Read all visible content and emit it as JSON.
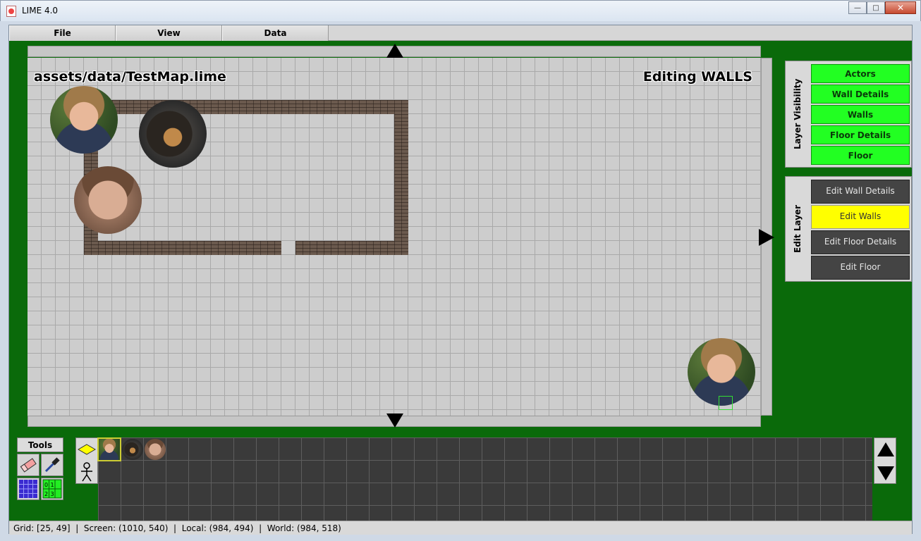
{
  "window": {
    "title": "LIME 4.0",
    "minimize_icon": "minimize-icon",
    "maximize_icon": "maximize-icon",
    "close_icon": "close-icon"
  },
  "menubar": {
    "items": [
      {
        "label": "File"
      },
      {
        "label": "View"
      },
      {
        "label": "Data"
      }
    ]
  },
  "map": {
    "filename": "assets/data/TestMap.lime",
    "mode": "Editing WALLS",
    "scroll_up_icon": "triangle-up-icon",
    "scroll_down_icon": "triangle-down-icon",
    "scroll_right_icon": "triangle-right-icon"
  },
  "layer_visibility": {
    "title": "Layer Visibility",
    "items": [
      {
        "label": "Actors"
      },
      {
        "label": "Wall Details"
      },
      {
        "label": "Walls"
      },
      {
        "label": "Floor Details"
      },
      {
        "label": "Floor"
      }
    ],
    "color": "#22ff22"
  },
  "edit_layer": {
    "title": "Edit Layer",
    "items": [
      {
        "label": "Edit Wall Details",
        "active": false
      },
      {
        "label": "Edit Walls",
        "active": true
      },
      {
        "label": "Edit Floor Details",
        "active": false
      },
      {
        "label": "Edit Floor",
        "active": false
      }
    ],
    "active_color": "#ffff00"
  },
  "tools": {
    "title": "Tools",
    "items": [
      "eraser-icon",
      "eyedropper-icon",
      "grid-icon",
      "numbered-grid-icon"
    ],
    "numbered_grid_text": "0 1 2 3"
  },
  "palette": {
    "tabs": [
      "tile-layer-icon",
      "actor-figure-icon"
    ],
    "scroll_up_icon": "triangle-up-icon",
    "scroll_down_icon": "triangle-down-icon"
  },
  "status": {
    "text": "Grid: [25, 49]  |  Screen: (1010, 540)  |  Local: (984, 494)  |  World: (984, 518)"
  }
}
